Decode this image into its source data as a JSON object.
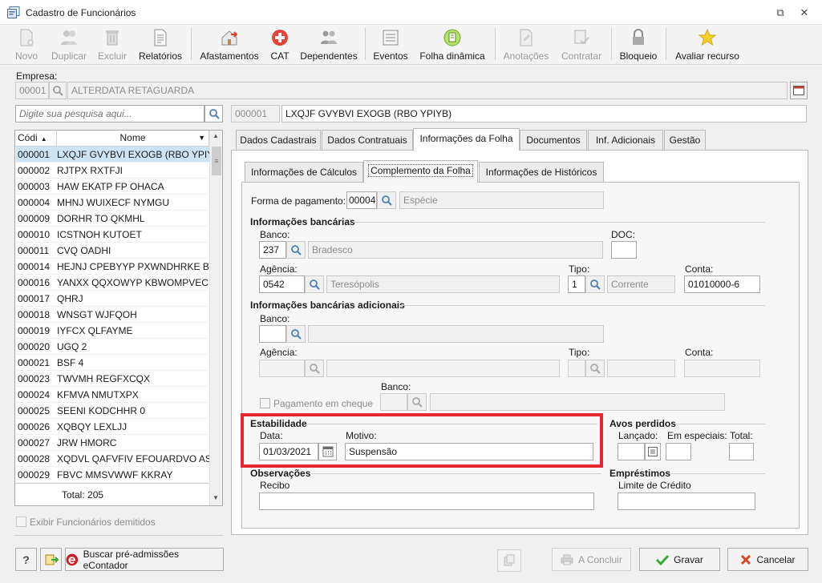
{
  "window": {
    "title": "Cadastro de Funcionários",
    "restore_glyph": "⧉",
    "close_glyph": "✕"
  },
  "toolbar": [
    {
      "id": "novo",
      "label": "Novo",
      "enabled": false,
      "icon": "new-document-icon"
    },
    {
      "id": "duplicar",
      "label": "Duplicar",
      "enabled": false,
      "icon": "duplicate-users-icon"
    },
    {
      "id": "excluir",
      "label": "Excluir",
      "enabled": false,
      "icon": "trash-icon"
    },
    {
      "id": "relatorios",
      "label": "Relatórios",
      "enabled": true,
      "icon": "report-icon"
    },
    {
      "id": "afastamentos",
      "label": "Afastamentos",
      "enabled": true,
      "icon": "house-arrow-icon"
    },
    {
      "id": "cat",
      "label": "CAT",
      "enabled": true,
      "icon": "red-cross-icon"
    },
    {
      "id": "dependentes",
      "label": "Dependentes",
      "enabled": true,
      "icon": "people-icon"
    },
    {
      "id": "eventos",
      "label": "Eventos",
      "enabled": true,
      "icon": "list-icon"
    },
    {
      "id": "folha",
      "label": "Folha dinâmica",
      "enabled": true,
      "icon": "dynamic-sheet-icon"
    },
    {
      "id": "anotacoes",
      "label": "Anotações",
      "enabled": false,
      "icon": "notes-icon"
    },
    {
      "id": "contratar",
      "label": "Contratar",
      "enabled": false,
      "icon": "hire-icon"
    },
    {
      "id": "bloqueio",
      "label": "Bloqueio",
      "enabled": true,
      "icon": "lock-icon"
    },
    {
      "id": "avaliar",
      "label": "Avaliar recurso",
      "enabled": true,
      "icon": "star-icon"
    }
  ],
  "empresa": {
    "label": "Empresa:",
    "code": "00001",
    "name": "ALTERDATA RETAGUARDA"
  },
  "search": {
    "placeholder": "Digite sua pesquisa aqui..."
  },
  "selected": {
    "code": "000001",
    "name": "LXQJF GVYBVI EXOGB (RBO YPIYB)"
  },
  "list": {
    "headers": {
      "code": "Códi",
      "name": "Nome"
    },
    "rows": [
      {
        "code": "000001",
        "name": "LXQJF GVYBVI EXOGB (RBO YPIYB)"
      },
      {
        "code": "000002",
        "name": "RJTPX RXTFJI"
      },
      {
        "code": "000003",
        "name": "HAW EKATP FP OHACA"
      },
      {
        "code": "000004",
        "name": "MHNJ WUIXECF NYMGU"
      },
      {
        "code": "000009",
        "name": "DORHR TO QKMHL"
      },
      {
        "code": "000010",
        "name": "ICSTNOH KUTOET"
      },
      {
        "code": "000011",
        "name": "CVQ OADHI"
      },
      {
        "code": "000014",
        "name": "HEJNJ CPEBYYP PXWNDHRKE BTB J"
      },
      {
        "code": "000016",
        "name": "YANXX QQXOWYP KBWOMPVEC A"
      },
      {
        "code": "000017",
        "name": "QHRJ"
      },
      {
        "code": "000018",
        "name": "WNSGT WJFQOH"
      },
      {
        "code": "000019",
        "name": "IYFCX QLFAYME"
      },
      {
        "code": "000020",
        "name": "UGQ 2"
      },
      {
        "code": "000021",
        "name": "BSF 4"
      },
      {
        "code": "000023",
        "name": "TWVMH REGFXCQX"
      },
      {
        "code": "000024",
        "name": "KFMVA NMUTXPX"
      },
      {
        "code": "000025",
        "name": "SEENI KODCHHR 0"
      },
      {
        "code": "000026",
        "name": "XQBQY LEXLJJ"
      },
      {
        "code": "000027",
        "name": "JRW HMORC"
      },
      {
        "code": "000028",
        "name": "XQDVL QAFVFIV EFOUARDVO AST U"
      },
      {
        "code": "000029",
        "name": "FBVC MMSVWWF KKRAY"
      }
    ],
    "total": "Total: 205"
  },
  "exibir_demitidos": "Exibir Funcionários demitidos",
  "tabs": [
    "Dados Cadastrais",
    "Dados Contratuais",
    "Informações da Folha",
    "Documentos",
    "Inf. Adicionais",
    "Gestão"
  ],
  "subtabs": [
    "Informações de Cálculos",
    "Complemento da Folha",
    "Informações de Históricos"
  ],
  "form": {
    "forma_pagamento": {
      "label": "Forma de pagamento:",
      "code": "00004",
      "desc": "Espécie"
    },
    "bancarias": {
      "title": "Informações bancárias",
      "banco_label": "Banco:",
      "banco_code": "237",
      "banco_name": "Bradesco",
      "doc_label": "DOC:",
      "agencia_label": "Agência:",
      "agencia_code": "0542",
      "agencia_name": "Teresópolis",
      "tipo_label": "Tipo:",
      "tipo_code": "1",
      "tipo_name": "Corrente",
      "conta_label": "Conta:",
      "conta_value": "01010000-6"
    },
    "adicionais": {
      "title": "Informações bancárias adicionais",
      "banco_label": "Banco:",
      "agencia_label": "Agência:",
      "tipo_label": "Tipo:",
      "conta_label": "Conta:",
      "banco2_label": "Banco:",
      "cheque_label": "Pagamento em cheque"
    },
    "estabilidade": {
      "title": "Estabilidade",
      "data_label": "Data:",
      "data_value": "01/03/2021",
      "motivo_label": "Motivo:",
      "motivo_value": "Suspensão"
    },
    "avos": {
      "title": "Avos perdidos",
      "lancado": "Lançado:",
      "especiais": "Em especiais:",
      "total": "Total:"
    },
    "observacoes": {
      "title": "Observações",
      "recibo": "Recibo"
    },
    "emprestimos": {
      "title": "Empréstimos",
      "limite": "Limite de Crédito"
    }
  },
  "footer": {
    "help": "?",
    "buscar": "Buscar pré-admissões eContador",
    "concluir": "A Concluir",
    "gravar": "Gravar",
    "cancelar": "Cancelar"
  },
  "colors": {
    "highlight": "#e8262d",
    "selection": "#cde4f7",
    "gravar_check": "#3aa935",
    "cancel_x": "#d9452b"
  }
}
